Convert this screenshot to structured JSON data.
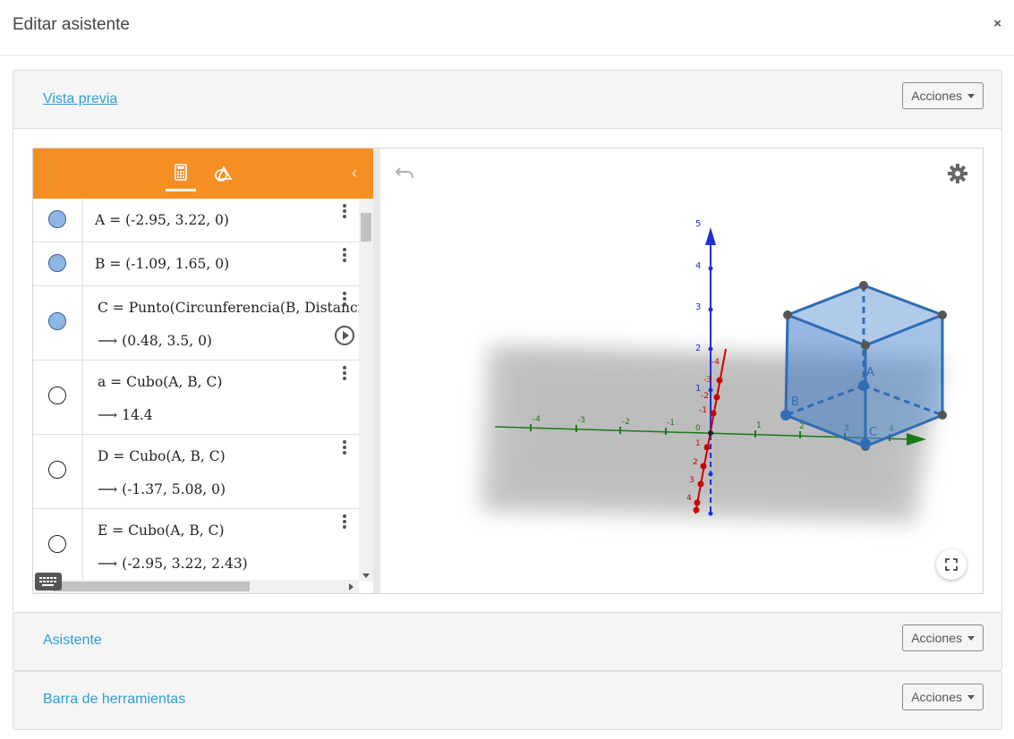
{
  "modal": {
    "title": "Editar asistente",
    "close": "×"
  },
  "panels": {
    "preview": {
      "link": "Vista previa",
      "actions": "Acciones"
    },
    "assistant": {
      "link": "Asistente",
      "actions": "Acciones"
    },
    "toolbar": {
      "link": "Barra de herramientas",
      "actions": "Acciones"
    }
  },
  "algebra": {
    "rows": [
      {
        "expr": "A = (-2.95, 3.22, 0)",
        "visible": true
      },
      {
        "expr": "B = (-1.09, 1.65, 0)",
        "visible": true
      },
      {
        "expr": "C = Punto(Circunferencia(B, Distancia(A",
        "output": "⟶  (0.48, 3.5, 0)",
        "visible": true
      },
      {
        "expr": "a = Cubo(A, B, C)",
        "output": "⟶  14.4",
        "visible": false
      },
      {
        "expr": "D = Cubo(A, B, C)",
        "output": "⟶  (-1.37, 5.08, 0)",
        "visible": false
      },
      {
        "expr": "E = Cubo(A, B, C)",
        "output": "⟶  (-2.95, 3.22, 2.43)",
        "visible": false
      }
    ]
  },
  "graphics3d": {
    "x_ticks": [
      "-4",
      "-3",
      "-2",
      "-1",
      "0",
      "1",
      "2",
      "3",
      "4"
    ],
    "z_ticks": [
      "1",
      "2",
      "3",
      "4",
      "5"
    ],
    "y_ticks_neg": [
      "-4",
      "-3",
      "-2",
      "-1"
    ],
    "y_ticks_pos": [
      "1",
      "2",
      "3",
      "4"
    ],
    "point_labels": [
      "A",
      "B",
      "C"
    ],
    "colors": {
      "x_axis": "#1a7a1a",
      "y_axis": "#cc0000",
      "z_axis": "#0000cc",
      "cube": "#2f6db5",
      "toolbar": "#f58f23"
    }
  }
}
